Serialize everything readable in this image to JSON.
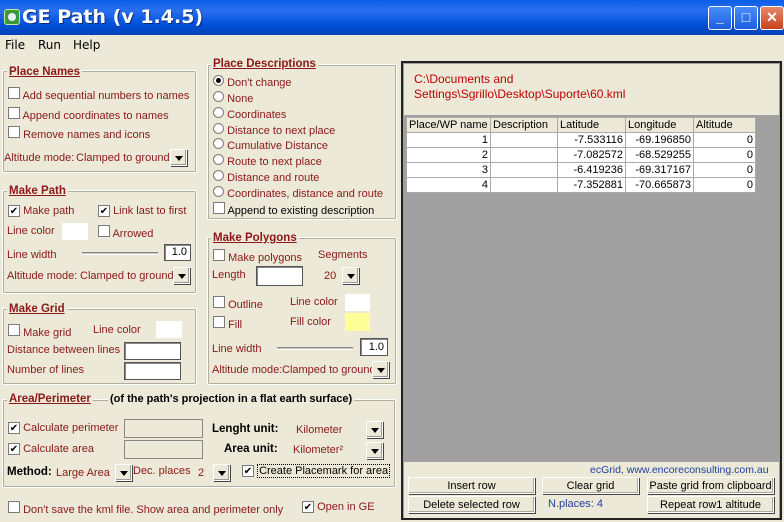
{
  "window": {
    "title": "GE Path (v 1.4.5)",
    "min": "_",
    "max": "□",
    "close": "✕"
  },
  "menu": [
    "File",
    "Run",
    "Help"
  ],
  "place_names": {
    "title": "Place Names",
    "opts": [
      "Add sequential numbers to names",
      "Append coordinates to names",
      "Remove names and icons"
    ],
    "alt_label": "Altitude mode:",
    "alt_value": "Clamped to ground"
  },
  "place_desc": {
    "title": "Place Descriptions",
    "radios": [
      "Don't change",
      "None",
      "Coordinates",
      "Distance to next place",
      "Cumulative Distance",
      "Route to next place",
      "Distance and route",
      "Coordinates, distance and route"
    ],
    "selected": 0,
    "append": "Append to existing description"
  },
  "make_path": {
    "title": "Make Path",
    "make": "Make path",
    "link": "Link last to first",
    "line_color": "Line color",
    "arrowed": "Arrowed",
    "width_label": "Line width",
    "width_value": "1.0",
    "alt_label": "Altitude mode:",
    "alt_value": "Clamped to ground"
  },
  "make_poly": {
    "title": "Make Polygons",
    "make": "Make polygons",
    "segments_label": "Segments",
    "length_label": "Length",
    "segments_value": "20",
    "outline": "Outline",
    "line_color": "Line color",
    "fill": "Fill",
    "fill_color": "Fill color",
    "fill_color_hex": "#ffff99",
    "width_label": "Line width",
    "width_value": "1.0",
    "alt_label": "Altitude mode:",
    "alt_value": "Clamped to ground"
  },
  "make_grid": {
    "title": "Make Grid",
    "make": "Make grid",
    "line_color": "Line color",
    "distance": "Distance between lines",
    "number": "Number of  lines"
  },
  "area": {
    "title": "Area/Perimeter",
    "subtitle": "(of the path's projection in a flat earth surface)",
    "calc_perim": "Calculate perimeter",
    "calc_area": "Calculate area",
    "length_unit_label": "Lenght unit:",
    "length_unit": "Kilometer",
    "area_unit_label": "Area unit:",
    "area_unit": "Kilometer²",
    "method_label": "Method:",
    "method": "Large Area",
    "dec_label": "Dec. places",
    "dec_value": "2",
    "create_placemark": "Create Placemark for area"
  },
  "bottom": {
    "dont_save": "Don't save the kml file. Show area and perimeter only",
    "open_ge": "Open in GE"
  },
  "right": {
    "path": "C:\\Documents and Settings\\Sgrillo\\Desktop\\Suporte\\60.kml",
    "columns": [
      "Place/WP name",
      "Description",
      "Latitude",
      "Longitude",
      "Altitude"
    ],
    "rows": [
      [
        "1",
        "",
        "-7.533116",
        "-69.196850",
        "0"
      ],
      [
        "2",
        "",
        "-7.082572",
        "-68.529255",
        "0"
      ],
      [
        "3",
        "",
        "-6.419236",
        "-69.317167",
        "0"
      ],
      [
        "4",
        "",
        "-7.352881",
        "-70.665873",
        "0"
      ]
    ],
    "credit": "ecGrid,  www.encoreconsulting.com.au",
    "insert_row": "Insert row",
    "clear_grid": "Clear grid",
    "paste_grid": "Paste grid from clipboard",
    "delete_row": "Delete selected row",
    "nplaces": "N.places: 4",
    "repeat_row": "Repeat row1 altitude"
  }
}
